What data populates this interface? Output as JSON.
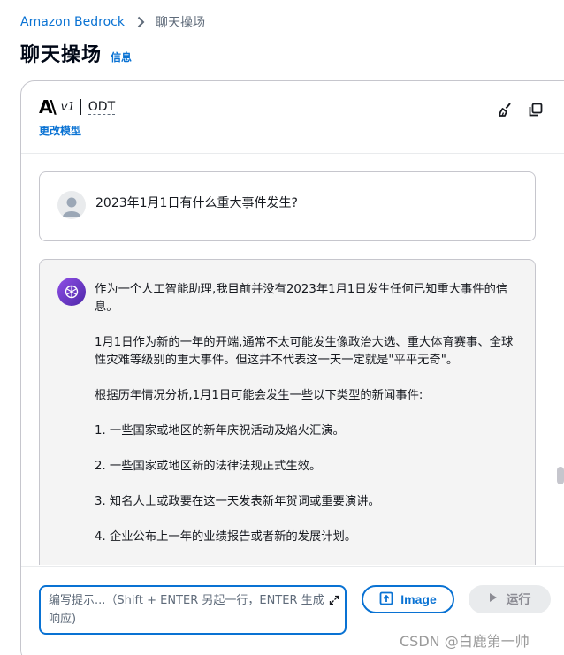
{
  "breadcrumb": {
    "root": "Amazon Bedrock",
    "current": "聊天操场"
  },
  "page": {
    "title": "聊天操场",
    "info": "信息"
  },
  "model": {
    "version": "v1",
    "name": "ODT",
    "change": "更改模型"
  },
  "messages": {
    "user": "2023年1月1日有什么重大事件发生?",
    "assistant": [
      "作为一个人工智能助理,我目前并没有2023年1月1日发生任何已知重大事件的信息。",
      "1月1日作为新的一年的开端,通常不太可能发生像政治大选、重大体育赛事、全球性灾难等级别的重大事件。但这并不代表这一天一定就是\"平平无奇\"。",
      "根据历年情况分析,1月1日可能会发生一些以下类型的新闻事件:",
      "1. 一些国家或地区的新年庆祝活动及焰火汇演。",
      "2. 一些国家或地区新的法律法规正式生效。",
      "3. 知名人士或政要在这一天发表新年贺词或重要演讲。",
      "4. 企业公布上一年的业绩报告或者新的发展计划。"
    ]
  },
  "input": {
    "placeholder": "编写提示...（Shift + ENTER 另起一行，ENTER 生成响应)"
  },
  "buttons": {
    "image": "Image",
    "run": "运行"
  },
  "watermark": "CSDN @白鹿第一帅",
  "icons": {
    "clear": "broom-icon",
    "copy": "copy-icon",
    "image": "image-upload-icon",
    "run": "play-icon"
  },
  "colors": {
    "link": "#0972d3",
    "ai_avatar": "#6b3ad1",
    "disabled_bg": "#e9ebed"
  }
}
